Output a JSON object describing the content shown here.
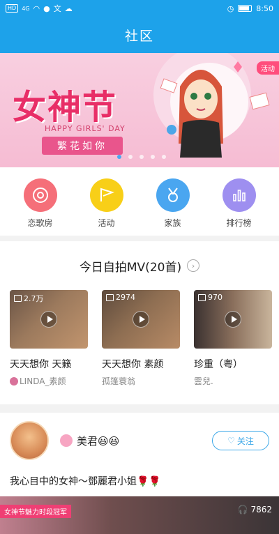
{
  "status_bar": {
    "time": "8:50",
    "left_icons": [
      "HD",
      "4G"
    ]
  },
  "header": {
    "title": "社区"
  },
  "banner": {
    "tag": "活动",
    "title": "女神节",
    "subtitle": "HAPPY GIRLS' DAY",
    "pill_text": "繁花如你",
    "page_count": 5,
    "active_index": 0
  },
  "categories": [
    {
      "label": "恋歌房",
      "icon": "microphone-icon",
      "color": "#f56f79"
    },
    {
      "label": "活动",
      "icon": "flag-icon",
      "color": "#f8cf18"
    },
    {
      "label": "家族",
      "icon": "medal-icon",
      "color": "#4aa6f0"
    },
    {
      "label": "排行榜",
      "icon": "bar-chart-icon",
      "color": "#9e8ff0"
    }
  ],
  "mv_section": {
    "title": "今日自拍MV(20首)",
    "items": [
      {
        "count": "2.7万",
        "title": "天天想你  天籁",
        "author": "LINDA_素颜"
      },
      {
        "count": "2974",
        "title": "天天想你  素颜",
        "author": "孤篷蓑翁"
      },
      {
        "count": "970",
        "title": "珍重（粤）",
        "author": "雲兒."
      }
    ]
  },
  "post": {
    "username": "美君😃😃",
    "follow_label": "关注",
    "text": "我心目中的女神～鄧麗君小姐🌹🌹",
    "media_tag": "女神节魅力时段冠军",
    "listen_count": "7862"
  }
}
